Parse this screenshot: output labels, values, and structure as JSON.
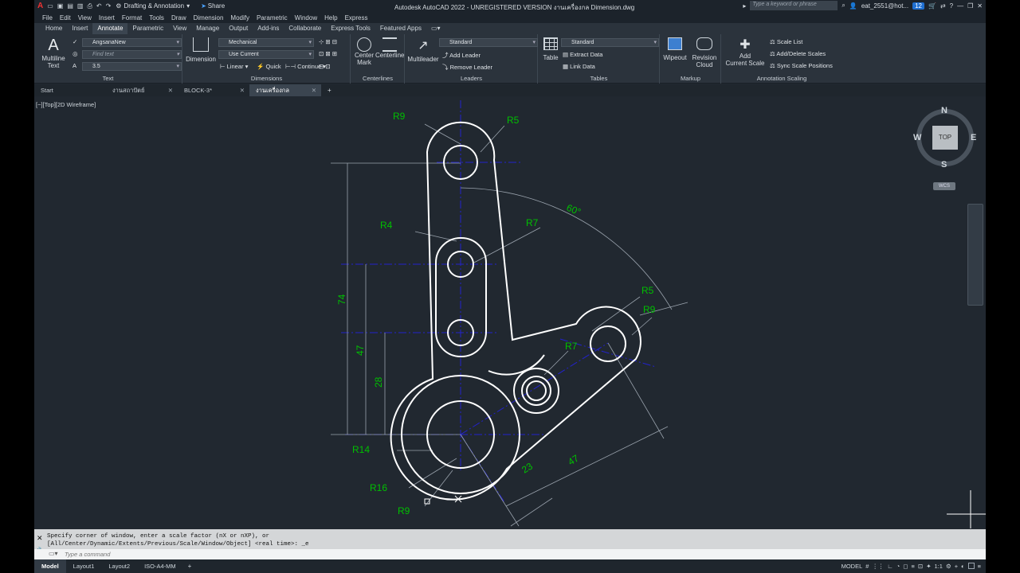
{
  "title_bar": {
    "workspace": "Drafting & Annotation",
    "share": "Share",
    "title": "Autodesk AutoCAD 2022 - UNREGISTERED VERSION    งานเครื่องกล Dimension.dwg",
    "search_placeholder": "Type a keyword or phrase",
    "user": "eat_2551@hot...",
    "notifications": "12",
    "help": "?"
  },
  "menu": [
    "File",
    "Edit",
    "View",
    "Insert",
    "Format",
    "Tools",
    "Draw",
    "Dimension",
    "Modify",
    "Parametric",
    "Window",
    "Help",
    "Express"
  ],
  "ribbon_tabs": [
    "Home",
    "Insert",
    "Annotate",
    "Parametric",
    "View",
    "Manage",
    "Output",
    "Add-ins",
    "Collaborate",
    "Express Tools",
    "Featured Apps"
  ],
  "active_ribbon_tab": "Annotate",
  "ribbon": {
    "text_panel": {
      "multiline_text": "Multiline",
      "multiline_text2": "Text",
      "font": "AngsanaNew",
      "find_placeholder": "Find text",
      "height": "3.5",
      "label": "Text"
    },
    "dim_panel": {
      "dimension": "Dimension",
      "style": "Mechanical",
      "layer": "Use Current",
      "linear": "Linear",
      "quick": "Quick",
      "continue": "Continue",
      "label": "Dimensions"
    },
    "centerlines_panel": {
      "center_mark": "Center",
      "center_mark2": "Mark",
      "centerline": "Centerline",
      "label": "Centerlines"
    },
    "leaders_panel": {
      "multileader": "Multileader",
      "style": "Standard",
      "add": "Add Leader",
      "remove": "Remove Leader",
      "label": "Leaders"
    },
    "tables_panel": {
      "table": "Table",
      "style": "Standard",
      "extract": "Extract Data",
      "link": "Link Data",
      "label": "Tables"
    },
    "markup_panel": {
      "wipeout": "Wipeout",
      "revision": "Revision",
      "revision2": "Cloud",
      "label": "Markup"
    },
    "scaling_panel": {
      "add_scale": "Add",
      "add_scale2": "Current Scale",
      "scale_list": "Scale List",
      "add_delete": "Add/Delete Scales",
      "sync": "Sync Scale Positions",
      "label": "Annotation Scaling"
    }
  },
  "doc_tabs": [
    {
      "label": "Start",
      "active": false,
      "closable": false
    },
    {
      "label": "งานสถาปัตย์ Dimension*",
      "active": false,
      "closable": true
    },
    {
      "label": "BLOCK-3*",
      "active": false,
      "closable": true
    },
    {
      "label": "งานเครื่องกล Dimension*",
      "active": true,
      "closable": true
    }
  ],
  "viewport_label": "[−][Top][2D Wireframe]",
  "viewcube": {
    "n": "N",
    "s": "S",
    "e": "E",
    "w": "W",
    "face": "TOP",
    "wcs": "WCS"
  },
  "drawing_labels": {
    "r9a": "R9",
    "r5a": "R5",
    "r4": "R4",
    "r7a": "R7",
    "r5b": "R5",
    "r9b": "R9",
    "r7b": "R7",
    "r14": "R14",
    "r16": "R16",
    "r9c": "R9",
    "d74": "74",
    "d47": "47",
    "d28": "28",
    "d23": "23",
    "d47b": "47",
    "a60": "60°"
  },
  "command": {
    "line1": "Specify corner of window, enter a scale factor (nX or nXP), or",
    "line2": "[All/Center/Dynamic/Extents/Previous/Scale/Window/Object] <real time>: _e",
    "placeholder": "Type a command"
  },
  "layout_tabs": [
    "Model",
    "Layout1",
    "Layout2",
    "ISO-A4-MM"
  ],
  "status": {
    "model": "MODEL",
    "scale": "1:1"
  },
  "colors": {
    "dimension_text": "#00c000",
    "geometry": "#ffffff",
    "centerline": "#2222cc",
    "dim_line": "#9aa3ad"
  }
}
